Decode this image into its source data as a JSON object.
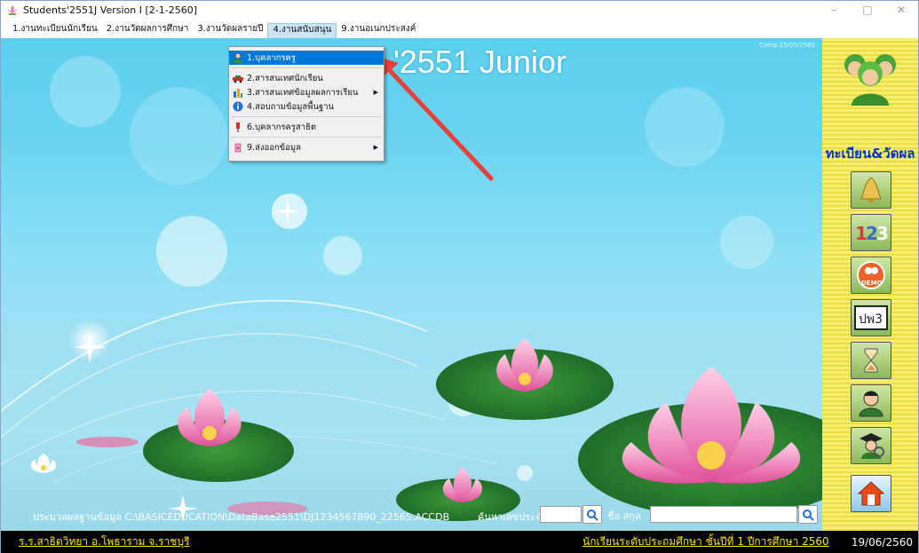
{
  "window": {
    "title": "Students'2551J Version I [2-1-2560]",
    "controls": [
      "–",
      "□",
      "✕"
    ]
  },
  "menu": [
    {
      "label": "1.งานทะเบียนนักเรียน"
    },
    {
      "label": "2.งานวัดผลการศึกษา"
    },
    {
      "label": "3.งานวัดผลรายปี"
    },
    {
      "label": "4.งานสนับสนุน"
    },
    {
      "label": "9.งานอเนกประสงค์"
    }
  ],
  "dropdown": {
    "items": [
      {
        "label": "1.บุคลากรครู",
        "icon": "teacher-icon",
        "selected": true
      },
      {
        "label": "2.สารสนเทศนักเรียน",
        "icon": "car-icon"
      },
      {
        "label": "3.สารสนเทศข้อมูลผลการเรียน",
        "icon": "bar-chart-icon",
        "submenu": true
      },
      {
        "label": "4.สอบถามข้อมูลพื้นฐาน",
        "icon": "info-icon"
      },
      {
        "label": "6.บุคลากรครูสาธิต",
        "icon": "pin-icon"
      },
      {
        "label": "9.ส่งออกข้อมูล",
        "icon": "export-icon",
        "submenu": true
      }
    ]
  },
  "desktop": {
    "title": "'2551 Junior",
    "copyright": "Comp.15/05/2560",
    "path_label": "ประมวลผลฐานข้อมูล C:\\BASICEDUCATION\\DataBase2551\\DJ1234567890_22565.ACCDB",
    "search_id_label": "ค้นหาเลขประจำตัว",
    "name_label": "ชื่อ สกุล"
  },
  "sidebar": {
    "title": "ทะเบียน&วัดผล",
    "buttons": [
      "bell",
      "123",
      "demo",
      "ปพ3",
      "hourglass",
      "person",
      "graduate",
      "home"
    ]
  },
  "status": {
    "school": "ร.ร.สาธิตวิทยา อ.โพธาราม จ.ราชบุรี",
    "level": "นักเรียนระดับประถมศึกษา ชั้นปีที่ 1 ปีการศึกษา 2560",
    "date": "19/06/2560"
  },
  "colors": {
    "accent": "#0078d7",
    "status_text": "#f6e600",
    "sidebar_title": "#0033cc"
  }
}
